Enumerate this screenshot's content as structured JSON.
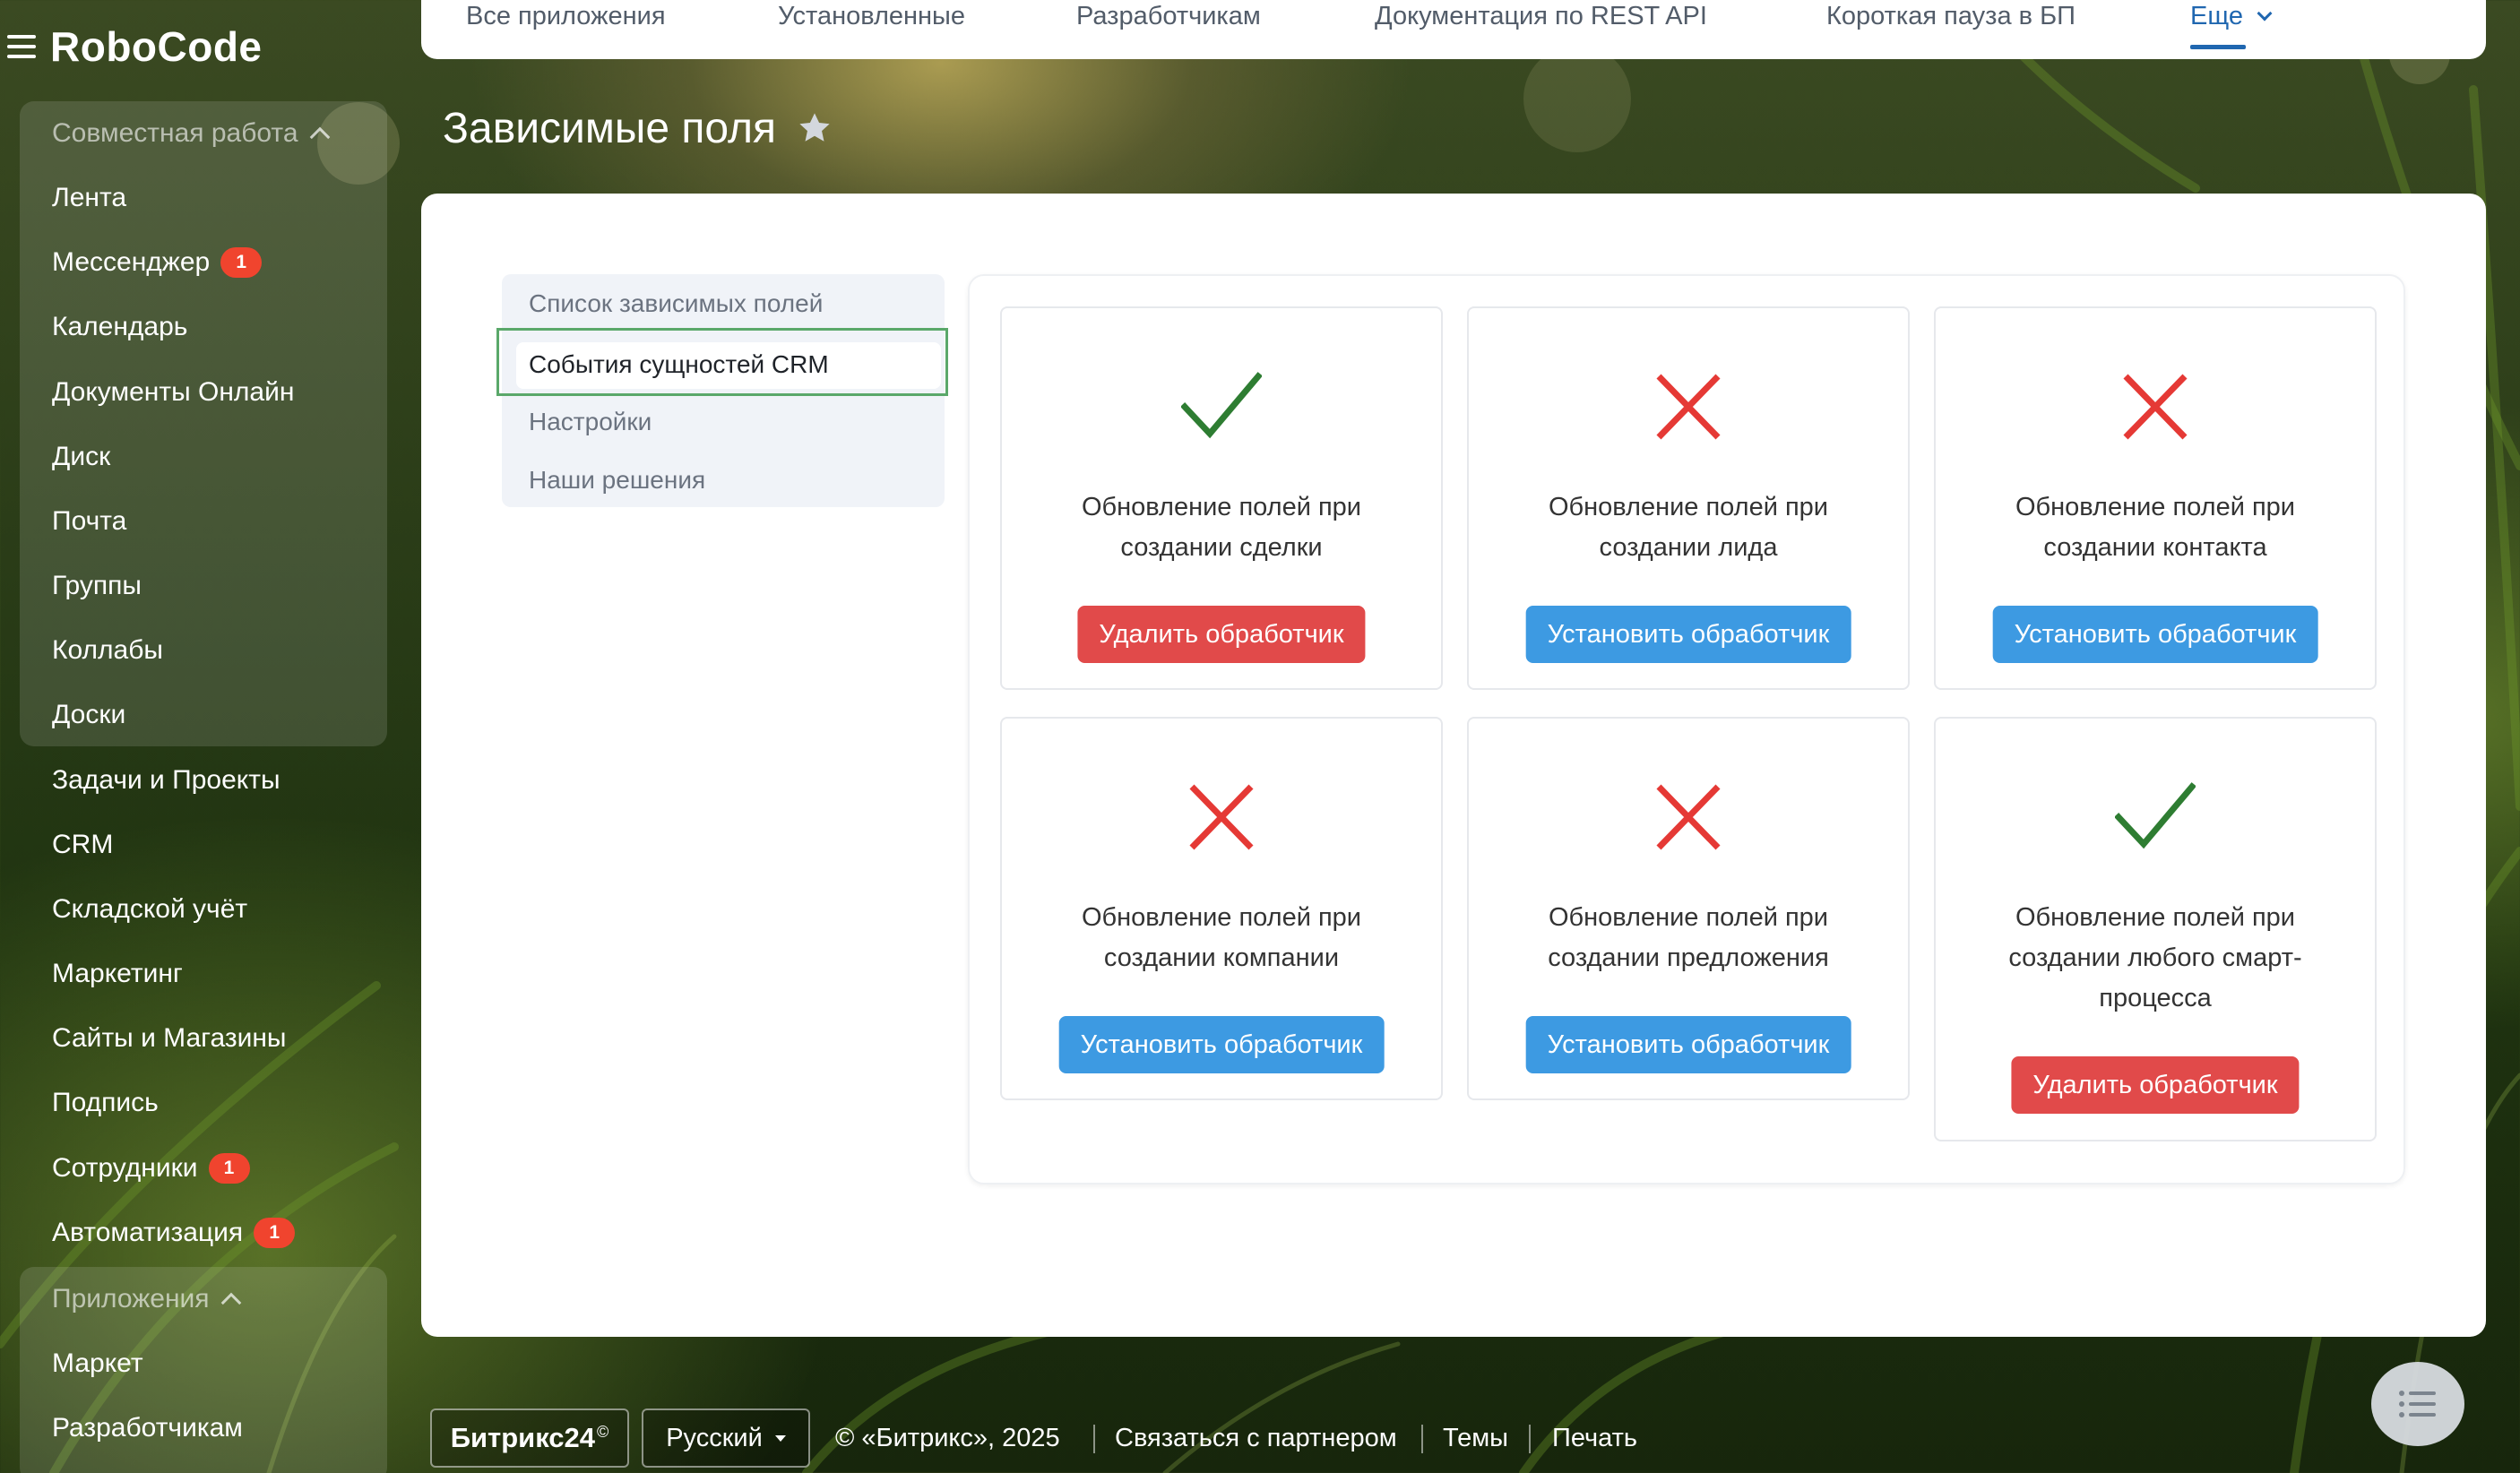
{
  "sidebar": {
    "brand": "RoboCode",
    "collab_heading": "Совместная работа",
    "items": [
      {
        "label": "Лента",
        "badge": ""
      },
      {
        "label": "Мессенджер",
        "badge": "1"
      },
      {
        "label": "Календарь",
        "badge": ""
      },
      {
        "label": "Документы Онлайн",
        "badge": ""
      },
      {
        "label": "Диск",
        "badge": ""
      },
      {
        "label": "Почта",
        "badge": ""
      },
      {
        "label": "Группы",
        "badge": ""
      },
      {
        "label": "Коллабы",
        "badge": ""
      },
      {
        "label": "Доски",
        "badge": ""
      },
      {
        "label": "Задачи и Проекты",
        "badge": ""
      },
      {
        "label": "CRM",
        "badge": ""
      },
      {
        "label": "Складской учёт",
        "badge": ""
      },
      {
        "label": "Маркетинг",
        "badge": ""
      },
      {
        "label": "Сайты и Магазины",
        "badge": ""
      },
      {
        "label": "Подпись",
        "badge": ""
      },
      {
        "label": "Сотрудники",
        "badge": "1"
      },
      {
        "label": "Автоматизация",
        "badge": "1"
      }
    ],
    "apps_heading": "Приложения",
    "apps_items": [
      {
        "label": "Маркет"
      },
      {
        "label": "Разработчикам"
      }
    ]
  },
  "topbar": {
    "tabs": [
      "Все приложения",
      "Установленные",
      "Разработчикам",
      "Документация по REST API",
      "Короткая пауза в БП"
    ],
    "more": "Еще"
  },
  "page": {
    "title": "Зависимые поля"
  },
  "menu": {
    "items": [
      "Список зависимых полей",
      "События сущностей CRM",
      "Настройки",
      "Наши решения"
    ],
    "active_index": 1
  },
  "cards": [
    {
      "status": "check",
      "text": "Обновление полей при создании сделки",
      "button": "Удалить обработчик",
      "button_type": "red"
    },
    {
      "status": "cross",
      "text": "Обновление полей при создании лида",
      "button": "Установить обработчик",
      "button_type": "blue"
    },
    {
      "status": "cross",
      "text": "Обновление полей при создании контакта",
      "button": "Установить обработчик",
      "button_type": "blue"
    },
    {
      "status": "cross",
      "text": "Обновление полей при создании компании",
      "button": "Установить обработчик",
      "button_type": "blue"
    },
    {
      "status": "cross",
      "text": "Обновление полей при создании предложения",
      "button": "Установить обработчик",
      "button_type": "blue"
    },
    {
      "status": "check",
      "text": "Обновление полей при создании любого смарт-процесса",
      "button": "Удалить обработчик",
      "button_type": "red"
    }
  ],
  "colors": {
    "check": "#2e7d32",
    "cross": "#e53935",
    "button_red": "#e14a4a",
    "button_blue": "#3d9ae2",
    "badge": "#f0442e",
    "accent": "#2067b0"
  },
  "footer": {
    "logo": "Битрикс24",
    "logo_mark": "©",
    "language": "Русский",
    "copyright": "© «Битрикс», 2025",
    "links": [
      "Связаться с партнером",
      "Темы",
      "Печать"
    ]
  },
  "icons": {
    "menu": "burger-menu-icon",
    "favorite": "star-icon",
    "chat": "chat-list-icon",
    "check": "check-icon",
    "cross": "cross-icon"
  }
}
